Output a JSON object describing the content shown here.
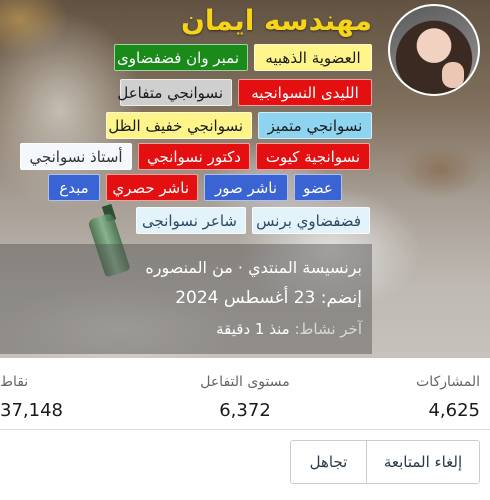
{
  "profile": {
    "name": "مهندسه ايمان",
    "colors": {
      "name": "#f7d417"
    }
  },
  "badges": [
    {
      "label": "العضوية الذهبيه",
      "style": "yellow"
    },
    {
      "label": "نمبر وان فضفضاوى",
      "style": "green"
    },
    {
      "label": "الليدى النسوانجيه",
      "style": "red"
    },
    {
      "label": "نسوانجي متفاعل",
      "style": "gray"
    },
    {
      "label": "نسوانجي متميز",
      "style": "lblue"
    },
    {
      "label": "نسوانجي خفيف الظل",
      "style": "yellow"
    },
    {
      "label": "نسوانجية كيوت",
      "style": "red"
    },
    {
      "label": "دكتور نسوانجي",
      "style": "red"
    },
    {
      "label": "أستاذ نسوانجي",
      "style": "white"
    },
    {
      "label": "عضو",
      "style": "blue"
    },
    {
      "label": "ناشر صور",
      "style": "blue"
    },
    {
      "label": "ناشر حصري",
      "style": "red"
    },
    {
      "label": "مبدع",
      "style": "blue"
    },
    {
      "label": "فضفضاوي برنس",
      "style": "pale"
    },
    {
      "label": "شاعر نسوانجى",
      "style": "pale"
    }
  ],
  "info": {
    "role_location": "برنسيسة المنتدي · من المنصوره",
    "joined": "إنضم: 23 أغسطس 2024",
    "last_active_label": "آخر نشاط:",
    "last_active_value": "منذ 1 دقيقة"
  },
  "stats": {
    "posts_label": "المشاركات",
    "posts_value": "4,625",
    "engagement_label": "مستوى التفاعل",
    "engagement_value": "6,372",
    "points_label": "نقاط",
    "points_value": "37,148"
  },
  "actions": {
    "unfollow": "إلغاء المتابعة",
    "ignore": "تجاهل"
  }
}
